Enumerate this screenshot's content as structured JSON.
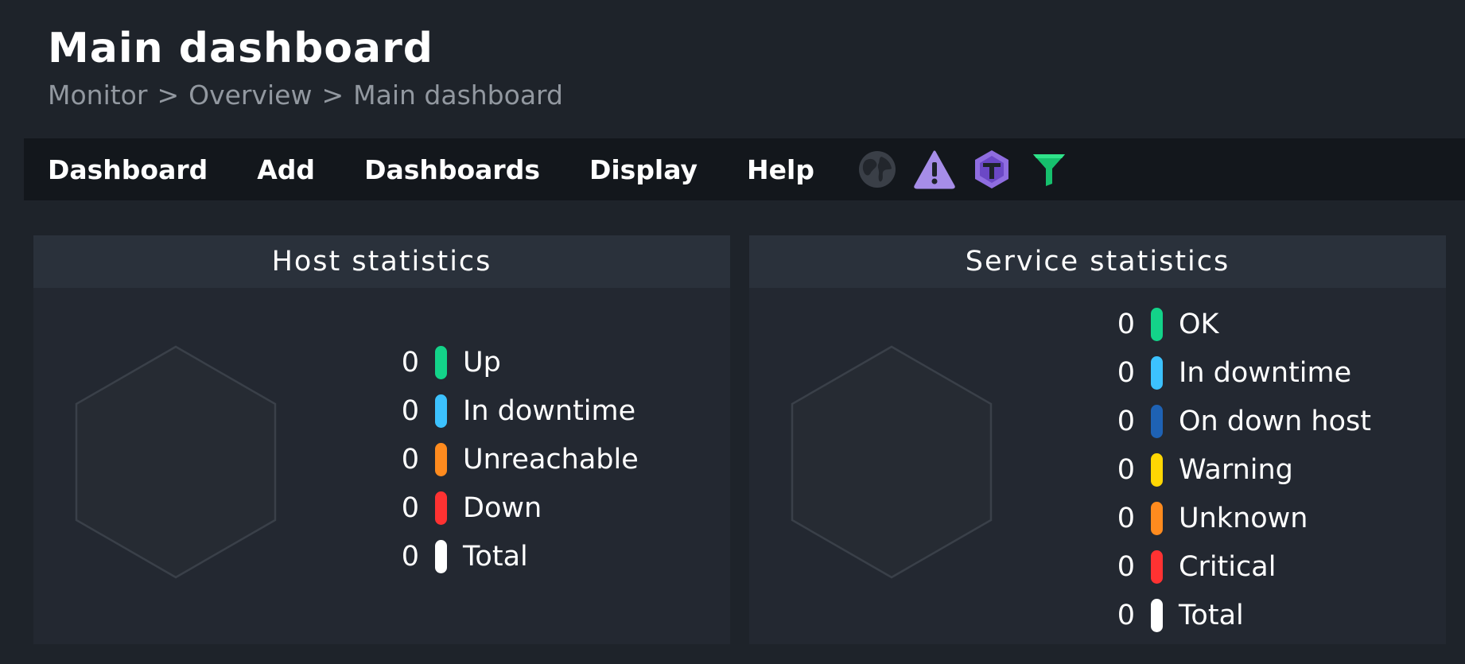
{
  "header": {
    "title": "Main dashboard",
    "breadcrumb": [
      "Monitor",
      "Overview",
      "Main dashboard"
    ],
    "breadcrumb_separator": ">"
  },
  "menu": {
    "items": [
      "Dashboard",
      "Add",
      "Dashboards",
      "Display",
      "Help"
    ],
    "icons": [
      "globe-icon",
      "warning-icon",
      "upgrade-icon",
      "filter-icon"
    ]
  },
  "host_stats": {
    "title": "Host statistics",
    "rows": [
      {
        "count": "0",
        "label": "Up",
        "color": "#13d389"
      },
      {
        "count": "0",
        "label": "In downtime",
        "color": "#3cc2ff"
      },
      {
        "count": "0",
        "label": "Unreachable",
        "color": "#ff8b1e"
      },
      {
        "count": "0",
        "label": "Down",
        "color": "#ff3232"
      },
      {
        "count": "0",
        "label": "Total",
        "color": "#ffffff"
      }
    ]
  },
  "service_stats": {
    "title": "Service statistics",
    "rows": [
      {
        "count": "0",
        "label": "OK",
        "color": "#13d389"
      },
      {
        "count": "0",
        "label": "In downtime",
        "color": "#3cc2ff"
      },
      {
        "count": "0",
        "label": "On down host",
        "color": "#1e62b4"
      },
      {
        "count": "0",
        "label": "Warning",
        "color": "#ffd703"
      },
      {
        "count": "0",
        "label": "Unknown",
        "color": "#ff8b1e"
      },
      {
        "count": "0",
        "label": "Critical",
        "color": "#ff3232"
      },
      {
        "count": "0",
        "label": "Total",
        "color": "#ffffff"
      }
    ]
  }
}
